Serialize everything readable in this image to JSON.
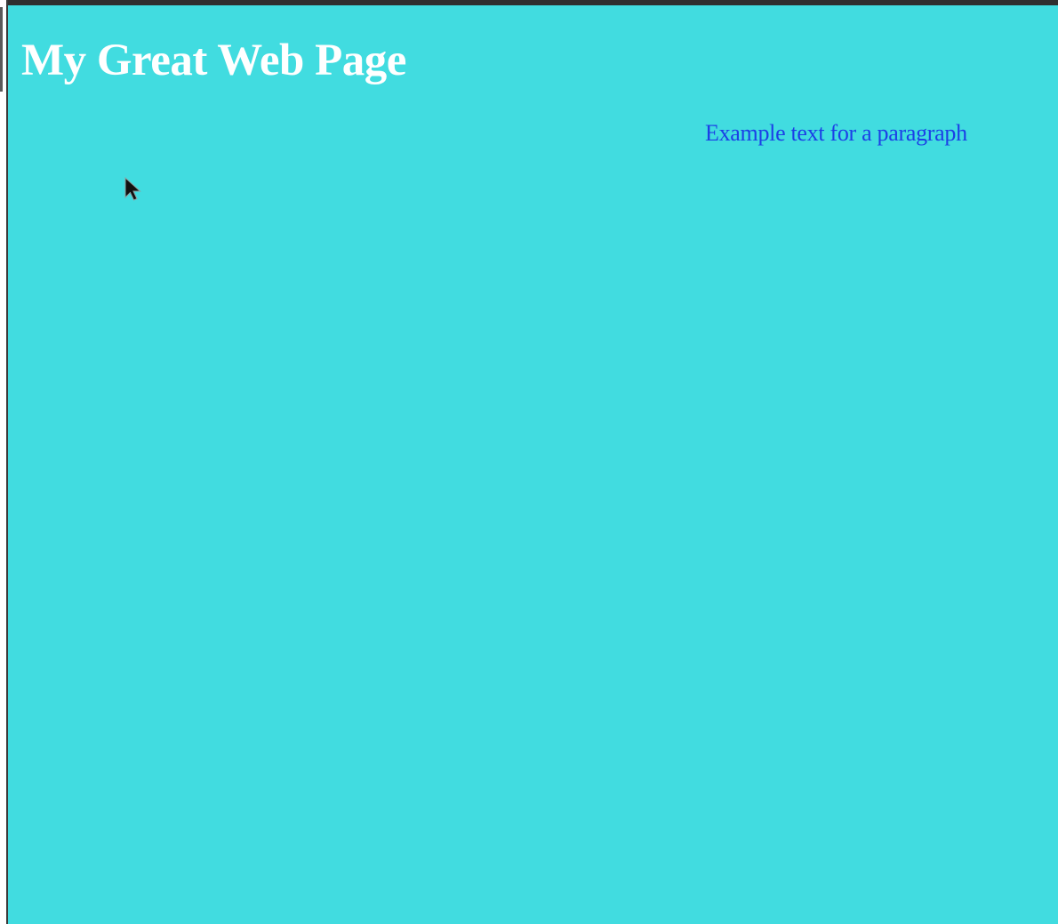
{
  "page": {
    "heading": "My Great Web Page",
    "paragraph": "Example text for a paragraph"
  },
  "colors": {
    "background": "#41dce0",
    "heading": "#ffffff",
    "paragraph": "#1c3fe6"
  },
  "icons": {
    "cursor": "mouse-pointer-icon"
  }
}
